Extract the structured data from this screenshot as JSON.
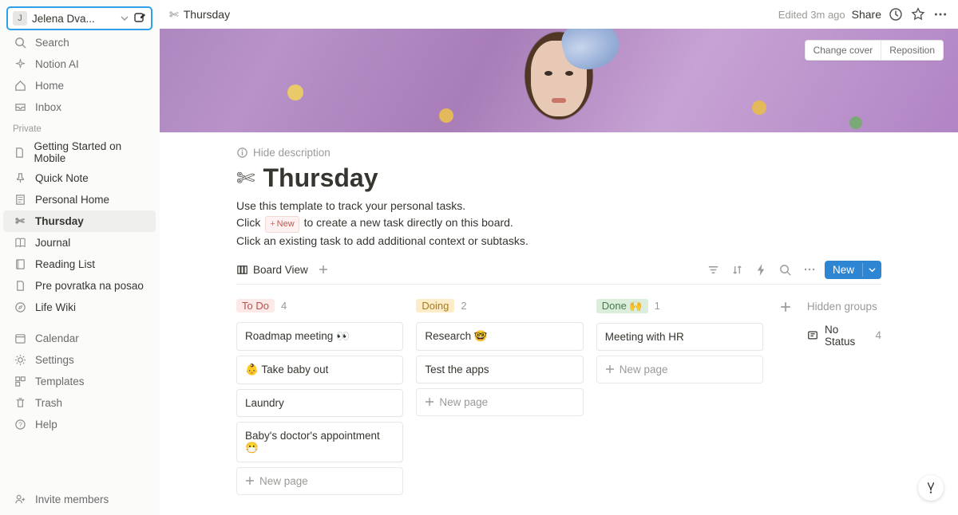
{
  "workspace": {
    "avatar_letter": "J",
    "name": "Jelena Dva..."
  },
  "sidebar": {
    "search": "Search",
    "ai": "Notion AI",
    "home": "Home",
    "inbox": "Inbox",
    "private_label": "Private",
    "pages": [
      {
        "label": "Getting Started on Mobile",
        "icon": "page"
      },
      {
        "label": "Quick Note",
        "icon": "pin"
      },
      {
        "label": "Personal Home",
        "icon": "doc"
      },
      {
        "label": "Thursday",
        "icon": "scissors",
        "active": true
      },
      {
        "label": "Journal",
        "icon": "book"
      },
      {
        "label": "Reading List",
        "icon": "bookmark"
      },
      {
        "label": "Pre povratka na posao",
        "icon": "page"
      },
      {
        "label": "Life Wiki",
        "icon": "compass"
      }
    ],
    "calendar": "Calendar",
    "settings": "Settings",
    "templates": "Templates",
    "trash": "Trash",
    "help": "Help",
    "invite": "Invite members"
  },
  "topbar": {
    "breadcrumb": "Thursday",
    "edited": "Edited 3m ago",
    "share": "Share"
  },
  "cover": {
    "change": "Change cover",
    "reposition": "Reposition"
  },
  "page": {
    "hide_desc": "Hide description",
    "title": "Thursday",
    "desc_1": "Use this template to track your personal tasks.",
    "desc_2a": "Click ",
    "desc_2_new": "New",
    "desc_2b": " to create a new task directly on this board.",
    "desc_3": "Click an existing task to add additional context or subtasks."
  },
  "viewbar": {
    "tab": "Board View",
    "new": "New"
  },
  "board": {
    "columns": [
      {
        "name": "To Do",
        "color_bg": "#fce9e8",
        "color_fg": "#b3534c",
        "count": "4",
        "cards": [
          "Roadmap meeting 👀",
          "👶 Take baby out",
          "Laundry",
          "Baby's doctor's appointment 😷"
        ]
      },
      {
        "name": "Doing",
        "color_bg": "#fdecc8",
        "color_fg": "#a67a24",
        "count": "2",
        "cards": [
          "Research 🤓",
          "Test the apps"
        ]
      },
      {
        "name": "Done 🙌",
        "color_bg": "#dbeddb",
        "color_fg": "#4a7a4a",
        "count": "1",
        "cards": [
          "Meeting with HR"
        ]
      }
    ],
    "new_page": "New page",
    "hidden_groups": "Hidden groups",
    "no_status_label": "No Status",
    "no_status_count": "4"
  }
}
